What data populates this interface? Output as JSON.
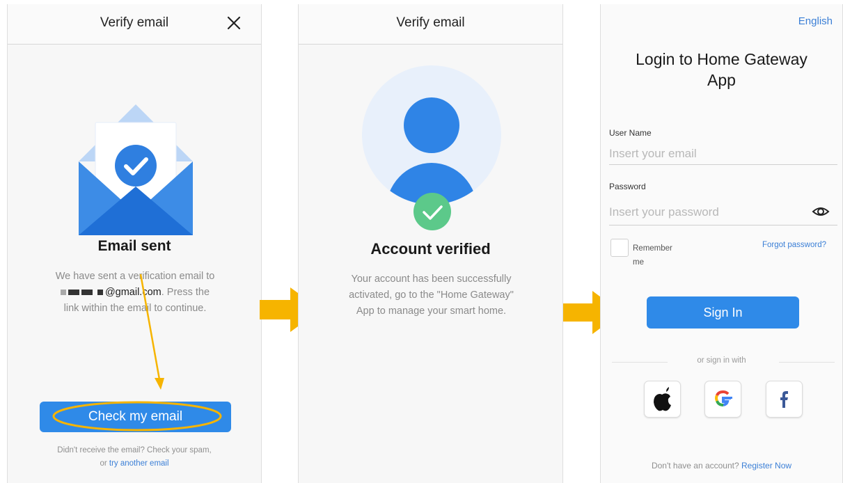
{
  "panel1": {
    "title": "Verify email",
    "heading": "Email sent",
    "body_line1": "We have sent a verification email to",
    "email_suffix": "@gmail.com",
    "body_line2_tail": ". Press the",
    "body_line3": "link within the email to continue.",
    "button_label": "Check my email",
    "footer_line1": "Didn't receive the email? Check your spam,",
    "footer_or": "or",
    "footer_link": "try another email"
  },
  "panel2": {
    "title": "Verify email",
    "heading": "Account verified",
    "body_line1": "Your account has been successfully",
    "body_line2": "activated, go to the \"Home Gateway\"",
    "body_line3": "App to manage your smart home."
  },
  "panel3": {
    "language": "English",
    "title_line1": "Login to Home Gateway",
    "title_line2": "App",
    "username_label": "User Name",
    "username_placeholder": "Insert your email",
    "password_label": "Password",
    "password_placeholder": "Insert your password",
    "remember_line1": "Remember",
    "remember_line2": "me",
    "forgot_password": "Forgot password?",
    "sign_in_label": "Sign In",
    "or_sign_in_with": "or sign in with",
    "no_account": "Don't have an account?",
    "register_link": "Register Now"
  },
  "icons": {
    "close": "close-icon",
    "envelope": "envelope-check-icon",
    "user": "user-verified-icon",
    "eye": "eye-icon",
    "apple": "apple-icon",
    "google": "google-icon",
    "facebook": "facebook-icon",
    "flow_arrow": "arrow-right-icon"
  },
  "colors": {
    "primary": "#2f8ae8",
    "annotation": "#f6b400",
    "success": "#5cc98a",
    "link": "#3b7fd6"
  }
}
